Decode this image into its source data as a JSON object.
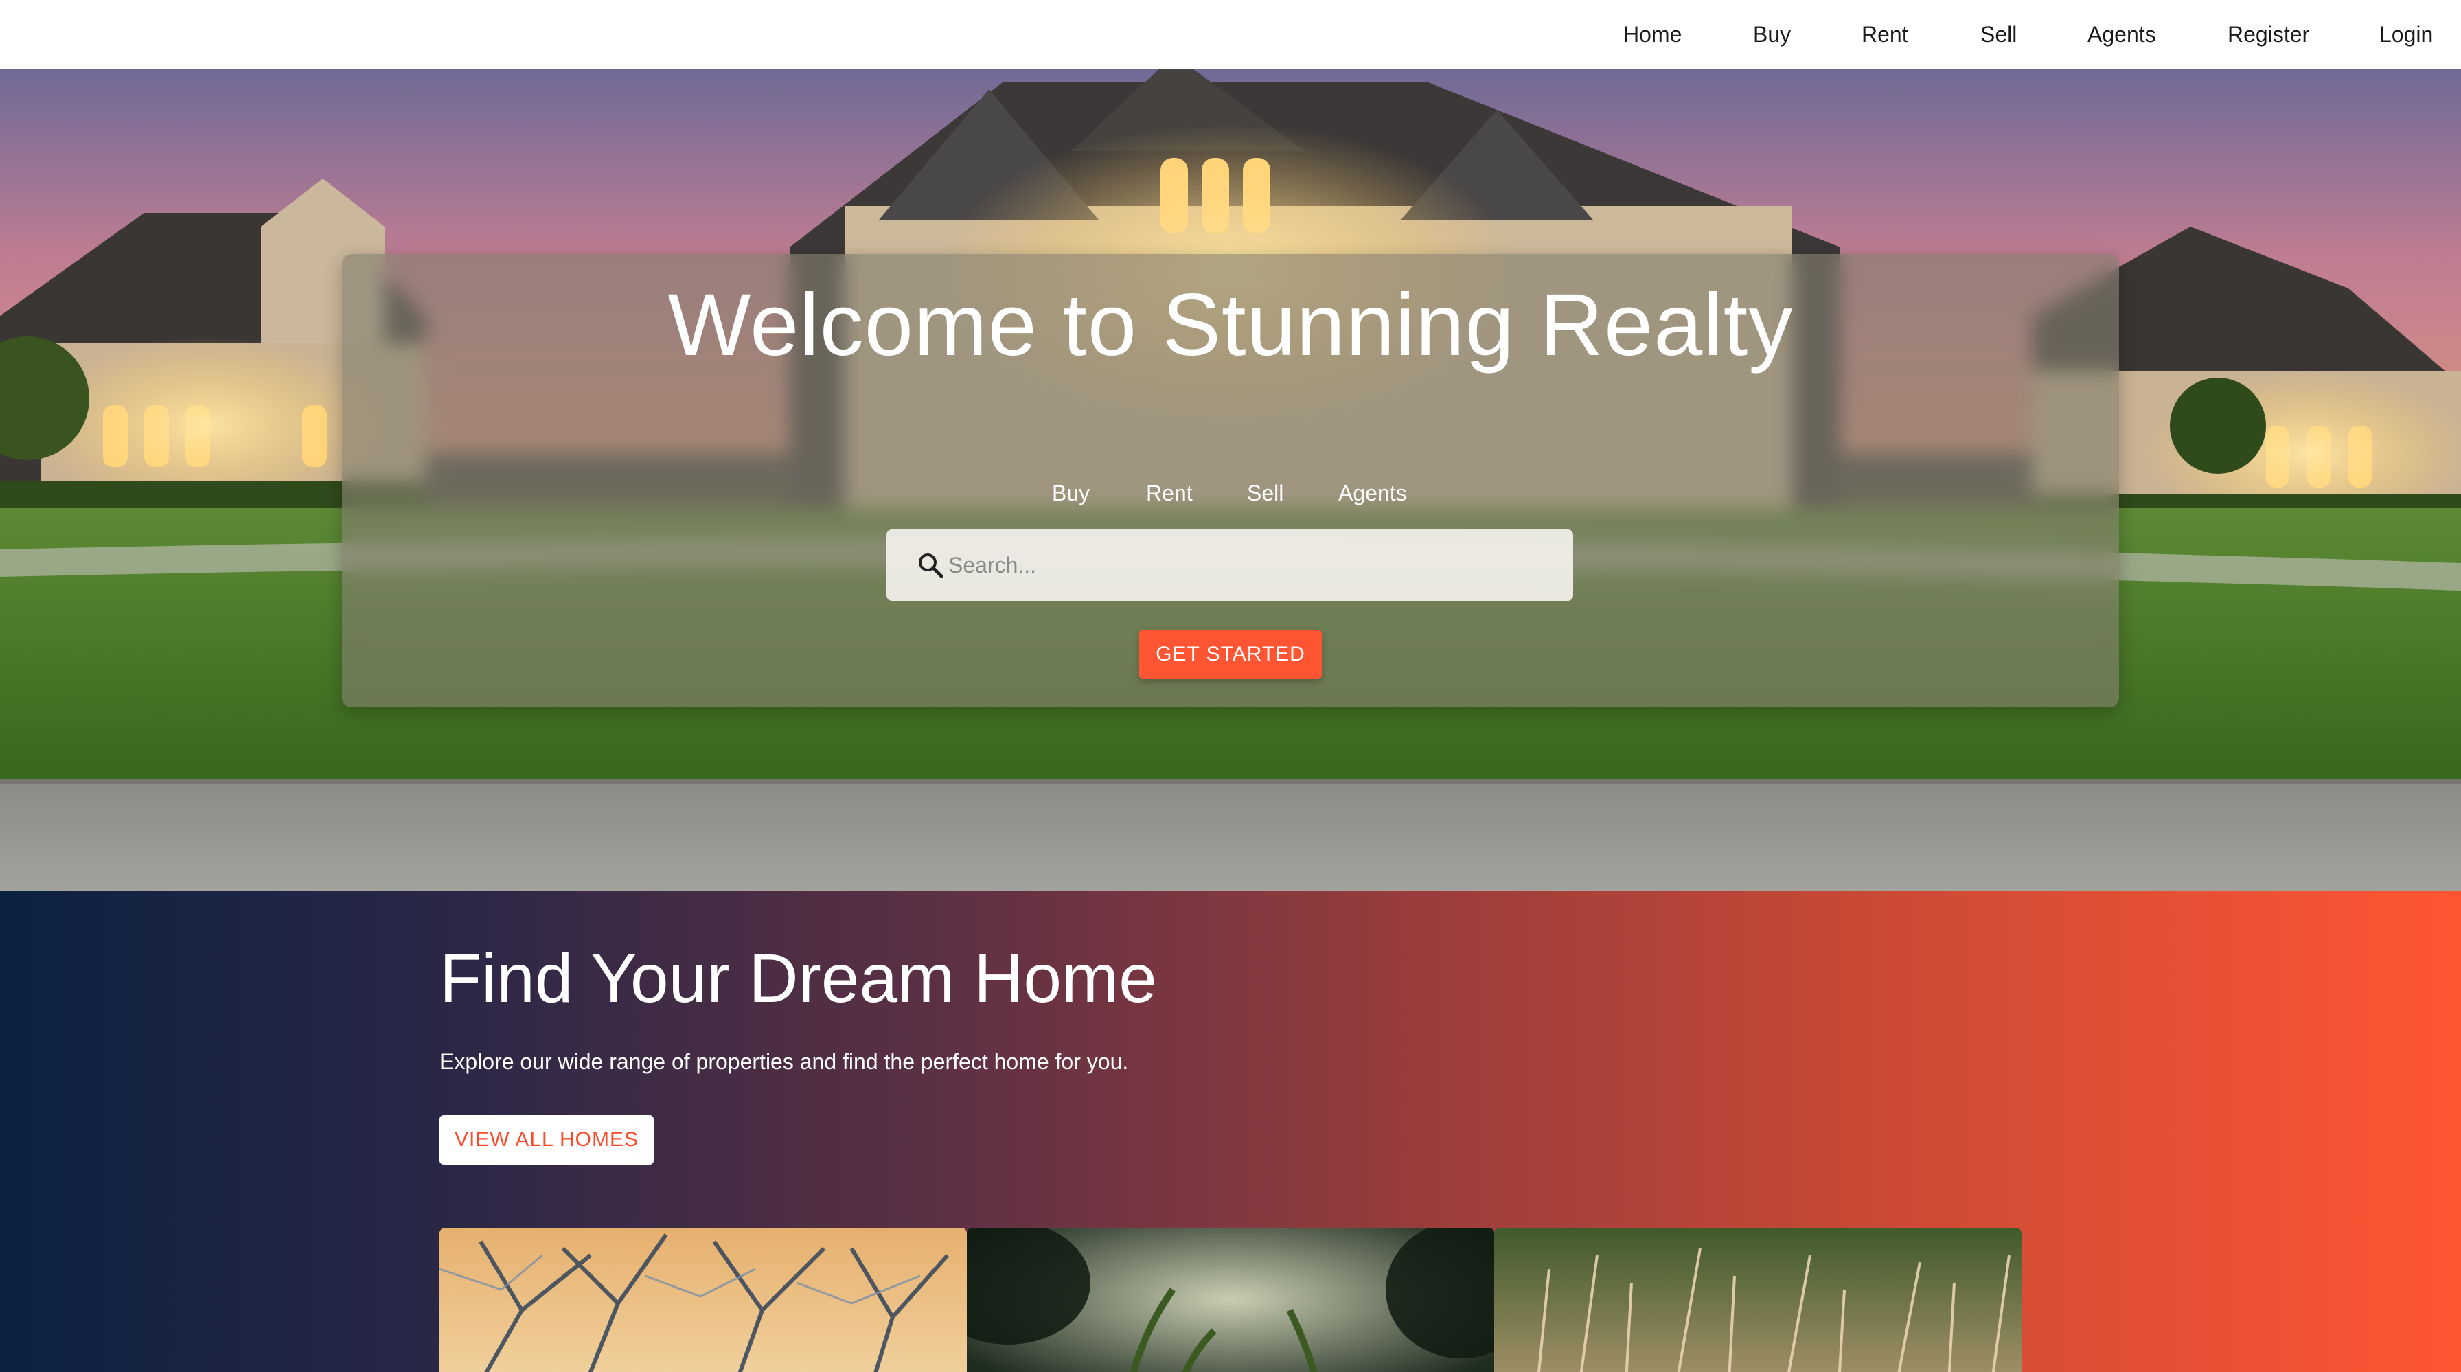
{
  "nav": {
    "items": [
      {
        "label": "Home"
      },
      {
        "label": "Buy"
      },
      {
        "label": "Rent"
      },
      {
        "label": "Sell"
      },
      {
        "label": "Agents"
      },
      {
        "label": "Register"
      },
      {
        "label": "Login"
      }
    ]
  },
  "hero": {
    "title": "Welcome to Stunning Realty",
    "links": [
      {
        "label": "Buy"
      },
      {
        "label": "Rent"
      },
      {
        "label": "Sell"
      },
      {
        "label": "Agents"
      }
    ],
    "search": {
      "placeholder": "Search...",
      "value": ""
    },
    "cta_label": "GET STARTED"
  },
  "dream": {
    "title": "Find Your Dream Home",
    "subtitle": "Explore our wide range of properties and find the perfect home for you.",
    "button_label": "VIEW ALL HOMES"
  },
  "icons": {
    "search": "search-icon"
  },
  "colors": {
    "accent": "#ff5533",
    "gradient_start": "#0c2142",
    "gradient_end": "#ff5533",
    "nav_text": "#1a1a1a"
  }
}
